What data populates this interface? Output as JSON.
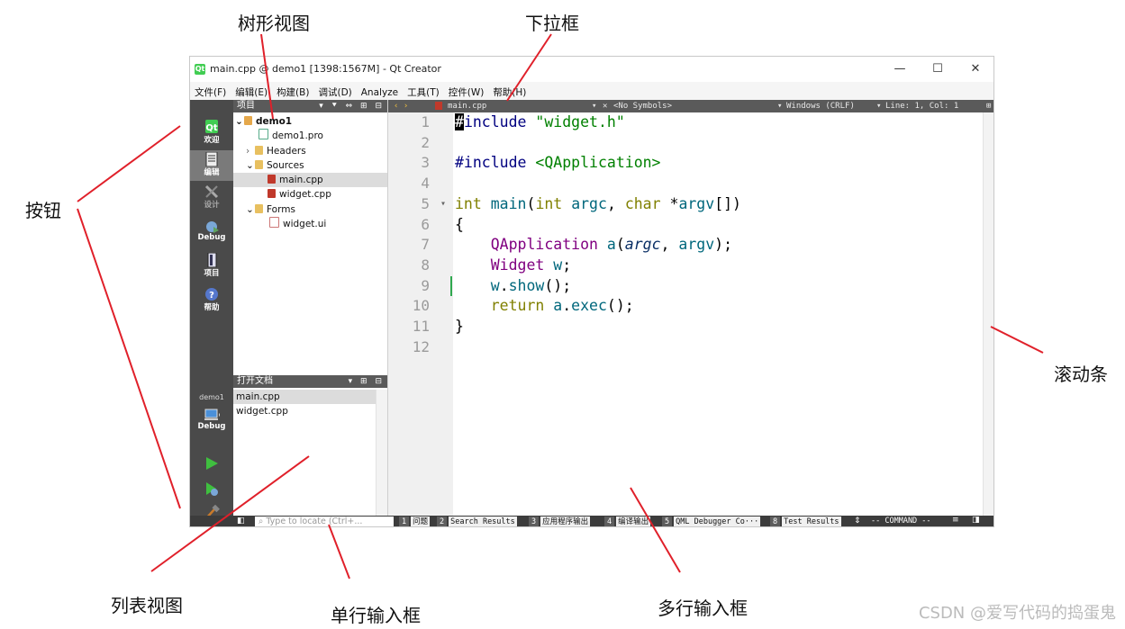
{
  "annotations": {
    "tree_view": "树形视图",
    "dropdown": "下拉框",
    "button": "按钮",
    "scrollbar": "滚动条",
    "list_view": "列表视图",
    "single_line_input": "单行输入框",
    "multi_line_input": "多行输入框"
  },
  "watermark": "CSDN @爱写代码的捣蛋鬼",
  "window": {
    "app_icon": "Qt",
    "title": "main.cpp @ demo1 [1398:1567M] - Qt Creator",
    "minimize": "—",
    "maximize": "☐",
    "close": "✕"
  },
  "menu": [
    "文件(F)",
    "编辑(E)",
    "构建(B)",
    "调试(D)",
    "Analyze",
    "工具(T)",
    "控件(W)",
    "帮助(H)"
  ],
  "modes": {
    "welcome": "欢迎",
    "edit": "编辑",
    "design": "设计",
    "debug": "Debug",
    "projects": "项目",
    "help": "帮助",
    "kit_project": "demo1",
    "kit_build": "Debug"
  },
  "project_pane": {
    "header": "项目",
    "tools": "▾ ⯆ ⇔ ⊞ ⊟",
    "tree": [
      {
        "toggle": "⌄",
        "label": "demo1"
      },
      {
        "toggle": "",
        "label": "demo1.pro"
      },
      {
        "toggle": "›",
        "label": "Headers"
      },
      {
        "toggle": "⌄",
        "label": "Sources"
      },
      {
        "toggle": "",
        "label": "main.cpp"
      },
      {
        "toggle": "",
        "label": "widget.cpp"
      },
      {
        "toggle": "⌄",
        "label": "Forms"
      },
      {
        "toggle": "",
        "label": "widget.ui"
      }
    ]
  },
  "open_docs": {
    "header": "打开文档",
    "tools": "▾ ⊞ ⊟",
    "items": [
      "main.cpp",
      "widget.cpp"
    ]
  },
  "editor_toolbar": {
    "nav": "‹ ›",
    "file": "main.cpp",
    "symbols": "<No Symbols>",
    "line_ending": "Windows (CRLF)",
    "position": "Line: 1, Col: 1"
  },
  "editor": {
    "line_numbers": [
      "1",
      "2",
      "3",
      "4",
      "5",
      "6",
      "7",
      "8",
      "9",
      "10",
      "11",
      "12"
    ],
    "fold_marker": "▾"
  },
  "status": {
    "locate_placeholder": "Type to locate (Ctrl+...",
    "tabs": [
      {
        "num": "1",
        "label": "问题"
      },
      {
        "num": "2",
        "label": "Search Results"
      },
      {
        "num": "3",
        "label": "应用程序输出"
      },
      {
        "num": "4",
        "label": "编译输出"
      },
      {
        "num": "5",
        "label": "QML Debugger Co···"
      },
      {
        "num": "8",
        "label": "Test Results"
      }
    ],
    "command": "-- COMMAND --"
  },
  "colors": {
    "mode_bar": "#4a4a4a",
    "pane_header": "#5a5a5a",
    "keyword": "#808000",
    "string": "#008000",
    "type": "#800080",
    "annotation_line": "#e0202a"
  }
}
